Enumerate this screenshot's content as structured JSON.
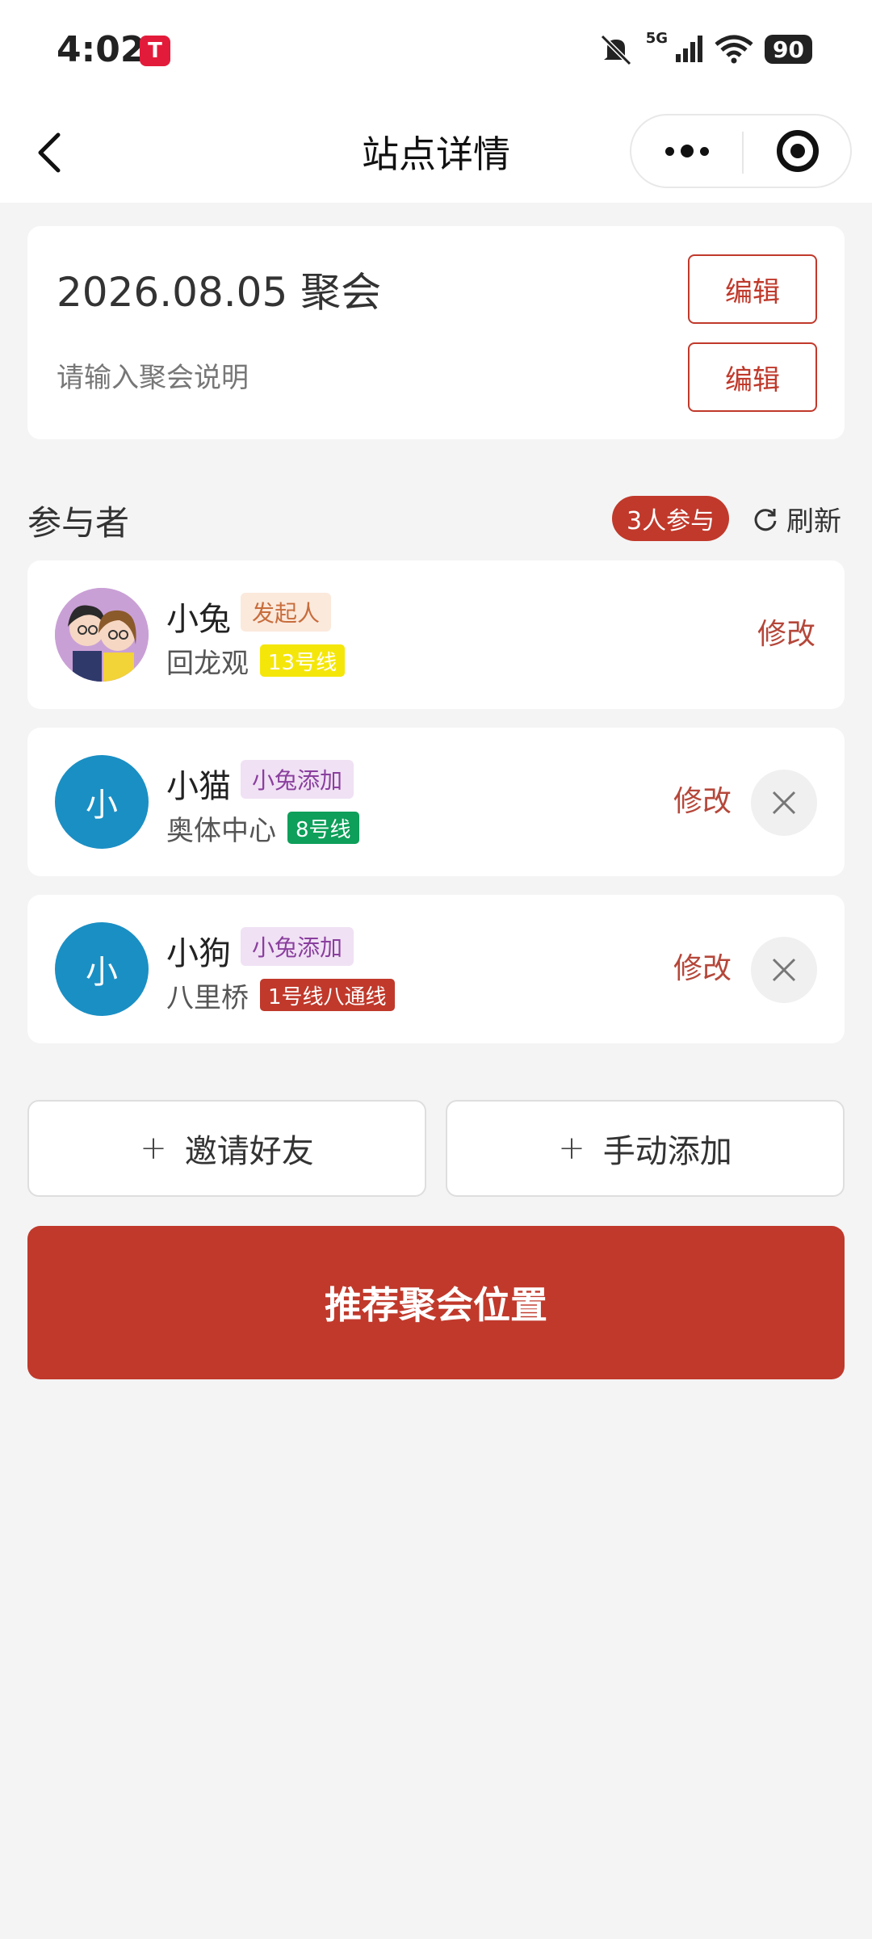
{
  "status_bar": {
    "time": "4:02",
    "app_icon": "T",
    "network": "5G",
    "battery": "90",
    "icons": [
      "mute-icon",
      "signal-icon",
      "wifi-icon",
      "battery-icon"
    ]
  },
  "nav": {
    "title": "站点详情",
    "back_icon": "chevron-left-icon",
    "more_icon": "more-dots-icon",
    "close_icon": "target-icon"
  },
  "event": {
    "title": "2026.08.05 聚会",
    "description_placeholder": "请输入聚会说明",
    "edit_title_label": "编辑",
    "edit_desc_label": "编辑"
  },
  "participants": {
    "section_title": "参与者",
    "count_label": "3人参与",
    "refresh_label": "刷新",
    "items": [
      {
        "name": "小兔",
        "tag": "发起人",
        "station": "回龙观",
        "line": "13号线",
        "line_color": "#f5e60a",
        "line_text_color": "#ffffff",
        "modify_label": "修改",
        "avatar_text": ""
      },
      {
        "name": "小猫",
        "tag": "小兔添加",
        "station": "奥体中心",
        "line": "8号线",
        "line_color": "#0e9f5a",
        "line_text_color": "#ffffff",
        "modify_label": "修改",
        "avatar_text": "小"
      },
      {
        "name": "小狗",
        "tag": "小兔添加",
        "station": "八里桥",
        "line": "1号线八通线",
        "line_color": "#c0392b",
        "line_text_color": "#ffffff",
        "modify_label": "修改",
        "avatar_text": "小"
      }
    ]
  },
  "actions": {
    "invite_label": "邀请好友",
    "manual_add_label": "手动添加",
    "plus_symbol": "+",
    "recommend_label": "推荐聚会位置"
  },
  "colors": {
    "accent": "#c0392b",
    "avatar_blue": "#1a8fc4"
  }
}
